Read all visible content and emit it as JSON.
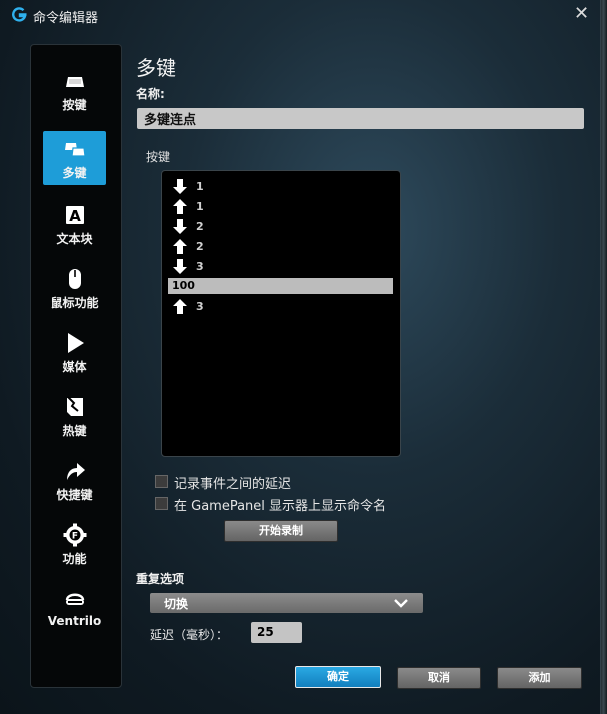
{
  "window": {
    "title": "命令编辑器",
    "close_label": "✕"
  },
  "sidebar": {
    "items": [
      {
        "label": "按键",
        "icon": "key-icon",
        "active": false
      },
      {
        "label": "多键",
        "icon": "multikey-icon",
        "active": true
      },
      {
        "label": "文本块",
        "icon": "text-block-icon",
        "active": false
      },
      {
        "label": "鼠标功能",
        "icon": "mouse-icon",
        "active": false
      },
      {
        "label": "媒体",
        "icon": "play-icon",
        "active": false
      },
      {
        "label": "热键",
        "icon": "hotkey-icon",
        "active": false
      },
      {
        "label": "快捷键",
        "icon": "shortcut-arrow-icon",
        "active": false
      },
      {
        "label": "功能",
        "icon": "function-gear-icon",
        "active": false
      },
      {
        "label": "Ventrilo",
        "icon": "headset-icon",
        "active": false
      }
    ]
  },
  "main": {
    "page_title": "多键",
    "name_label": "名称:",
    "name_value": "多键连点",
    "keys_label": "按键",
    "keystrokes": [
      {
        "dir": "down",
        "key": "1"
      },
      {
        "dir": "up",
        "key": "1"
      },
      {
        "dir": "down",
        "key": "2"
      },
      {
        "dir": "up",
        "key": "2"
      },
      {
        "dir": "down",
        "key": "3"
      },
      {
        "dir": "delay",
        "key": "100"
      },
      {
        "dir": "up",
        "key": "3"
      }
    ],
    "record_delays_label": "记录事件之间的延迟",
    "show_in_gamepanel_label": "在 GamePanel 显示器上显示命令名",
    "start_record_label": "开始录制",
    "repeat_options_label": "重复选项",
    "repeat_mode_value": "切换",
    "delay_label": "延迟（毫秒）：",
    "delay_value": "25"
  },
  "footer": {
    "ok_label": "确定",
    "cancel_label": "取消",
    "add_label": "添加"
  },
  "colors": {
    "accent": "#1e9dd8",
    "panel": "#050708",
    "button": "#787878"
  }
}
